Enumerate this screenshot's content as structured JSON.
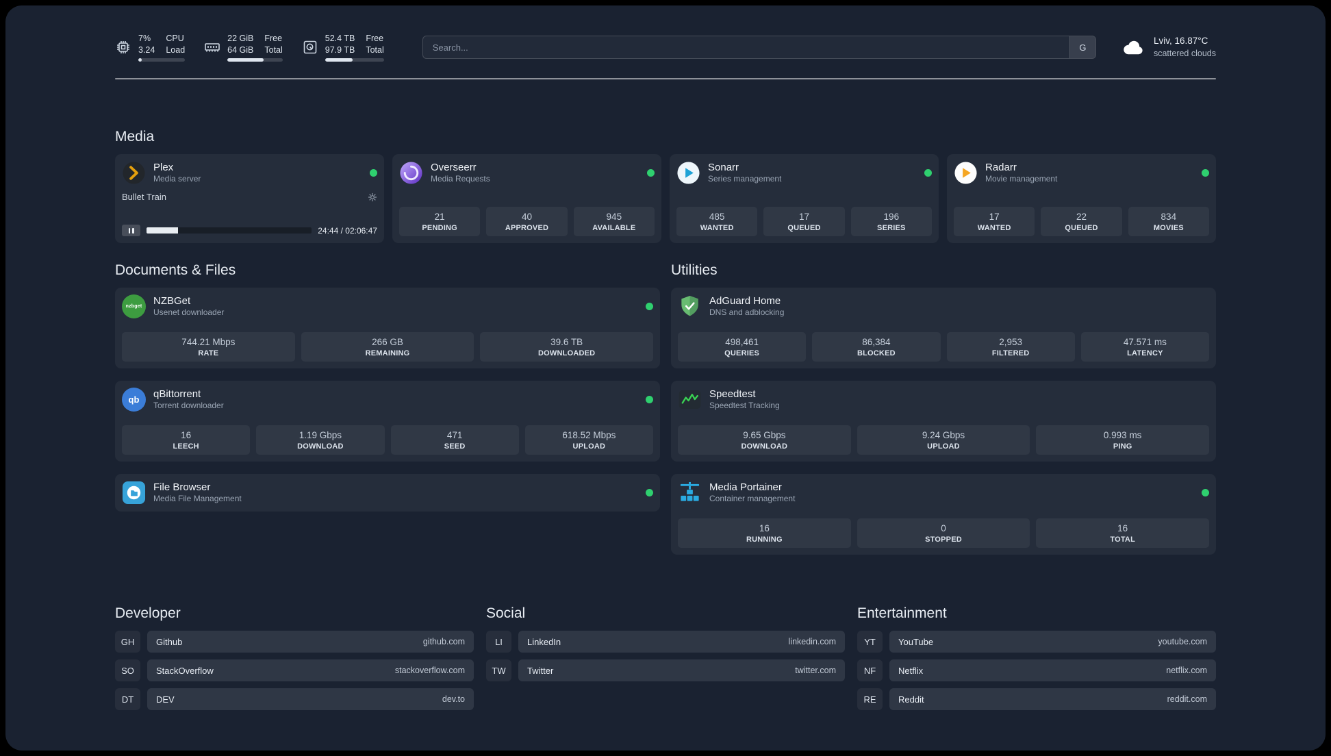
{
  "topbar": {
    "cpu": {
      "value": "7%",
      "sub": "3.24",
      "label_top": "CPU",
      "label_bottom": "Load",
      "progress": 7
    },
    "memory": {
      "value": "22 GiB",
      "sub": "64 GiB",
      "label_top": "Free",
      "label_bottom": "Total",
      "progress": 66
    },
    "disk": {
      "value": "52.4 TB",
      "sub": "97.9 TB",
      "label_top": "Free",
      "label_bottom": "Total",
      "progress": 47
    },
    "search": {
      "placeholder": "Search...",
      "button_label": "G"
    },
    "weather": {
      "location": "Lviv, 16.87°C",
      "condition": "scattered clouds"
    }
  },
  "sections": {
    "media": {
      "title": "Media",
      "plex": {
        "name": "Plex",
        "desc": "Media server",
        "now_playing": {
          "title": "Bullet Train",
          "time": "24:44 / 02:06:47",
          "progress": 19
        }
      },
      "overseerr": {
        "name": "Overseerr",
        "desc": "Media Requests",
        "stats": [
          {
            "value": "21",
            "label": "PENDING"
          },
          {
            "value": "40",
            "label": "APPROVED"
          },
          {
            "value": "945",
            "label": "AVAILABLE"
          }
        ]
      },
      "sonarr": {
        "name": "Sonarr",
        "desc": "Series management",
        "stats": [
          {
            "value": "485",
            "label": "WANTED"
          },
          {
            "value": "17",
            "label": "QUEUED"
          },
          {
            "value": "196",
            "label": "SERIES"
          }
        ]
      },
      "radarr": {
        "name": "Radarr",
        "desc": "Movie management",
        "stats": [
          {
            "value": "17",
            "label": "WANTED"
          },
          {
            "value": "22",
            "label": "QUEUED"
          },
          {
            "value": "834",
            "label": "MOVIES"
          }
        ]
      }
    },
    "documents": {
      "title": "Documents & Files",
      "nzbget": {
        "name": "NZBGet",
        "desc": "Usenet downloader",
        "stats": [
          {
            "value": "744.21 Mbps",
            "label": "RATE"
          },
          {
            "value": "266 GB",
            "label": "REMAINING"
          },
          {
            "value": "39.6 TB",
            "label": "DOWNLOADED"
          }
        ]
      },
      "qbittorrent": {
        "name": "qBittorrent",
        "desc": "Torrent downloader",
        "stats": [
          {
            "value": "16",
            "label": "LEECH"
          },
          {
            "value": "1.19 Gbps",
            "label": "DOWNLOAD"
          },
          {
            "value": "471",
            "label": "SEED"
          },
          {
            "value": "618.52 Mbps",
            "label": "UPLOAD"
          }
        ]
      },
      "filebrowser": {
        "name": "File Browser",
        "desc": "Media File Management"
      }
    },
    "utilities": {
      "title": "Utilities",
      "adguard": {
        "name": "AdGuard Home",
        "desc": "DNS and adblocking",
        "stats": [
          {
            "value": "498,461",
            "label": "QUERIES"
          },
          {
            "value": "86,384",
            "label": "BLOCKED"
          },
          {
            "value": "2,953",
            "label": "FILTERED"
          },
          {
            "value": "47.571 ms",
            "label": "LATENCY"
          }
        ]
      },
      "speedtest": {
        "name": "Speedtest",
        "desc": "Speedtest Tracking",
        "stats": [
          {
            "value": "9.65 Gbps",
            "label": "DOWNLOAD"
          },
          {
            "value": "9.24 Gbps",
            "label": "UPLOAD"
          },
          {
            "value": "0.993 ms",
            "label": "PING"
          }
        ]
      },
      "portainer": {
        "name": "Media Portainer",
        "desc": "Container management",
        "stats": [
          {
            "value": "16",
            "label": "RUNNING"
          },
          {
            "value": "0",
            "label": "STOPPED"
          },
          {
            "value": "16",
            "label": "TOTAL"
          }
        ]
      }
    },
    "bookmarks": {
      "developer": {
        "title": "Developer",
        "links": [
          {
            "abbr": "GH",
            "name": "Github",
            "domain": "github.com"
          },
          {
            "abbr": "SO",
            "name": "StackOverflow",
            "domain": "stackoverflow.com"
          },
          {
            "abbr": "DT",
            "name": "DEV",
            "domain": "dev.to"
          }
        ]
      },
      "social": {
        "title": "Social",
        "links": [
          {
            "abbr": "LI",
            "name": "LinkedIn",
            "domain": "linkedin.com"
          },
          {
            "abbr": "TW",
            "name": "Twitter",
            "domain": "twitter.com"
          }
        ]
      },
      "entertainment": {
        "title": "Entertainment",
        "links": [
          {
            "abbr": "YT",
            "name": "YouTube",
            "domain": "youtube.com"
          },
          {
            "abbr": "NF",
            "name": "Netflix",
            "domain": "netflix.com"
          },
          {
            "abbr": "RE",
            "name": "Reddit",
            "domain": "reddit.com"
          }
        ]
      }
    }
  },
  "icons": {
    "cpu": "chip",
    "memory": "ram-stick",
    "disk": "hard-drive",
    "weather": "cloud",
    "settings": "gear",
    "pause": "pause-bars",
    "nzbget_label": "nzbget",
    "qbittorrent_label": "qb"
  },
  "colors": {
    "status_online": "#2fd06f",
    "plex_amber": "#e5a00d",
    "overseerr_purple": "#6d3fd4",
    "sonarr_blue": "#1ea2d6",
    "radarr_orange": "#f5a623",
    "nzbget_green": "#3d9c40",
    "qbittorrent_blue": "#3b7dd8",
    "adguard_green": "#68bc71",
    "speedtest_green": "#39d353",
    "portainer_blue": "#2aabe2",
    "filebrowser_blue": "#37a3d9",
    "background": "#1a2231"
  }
}
